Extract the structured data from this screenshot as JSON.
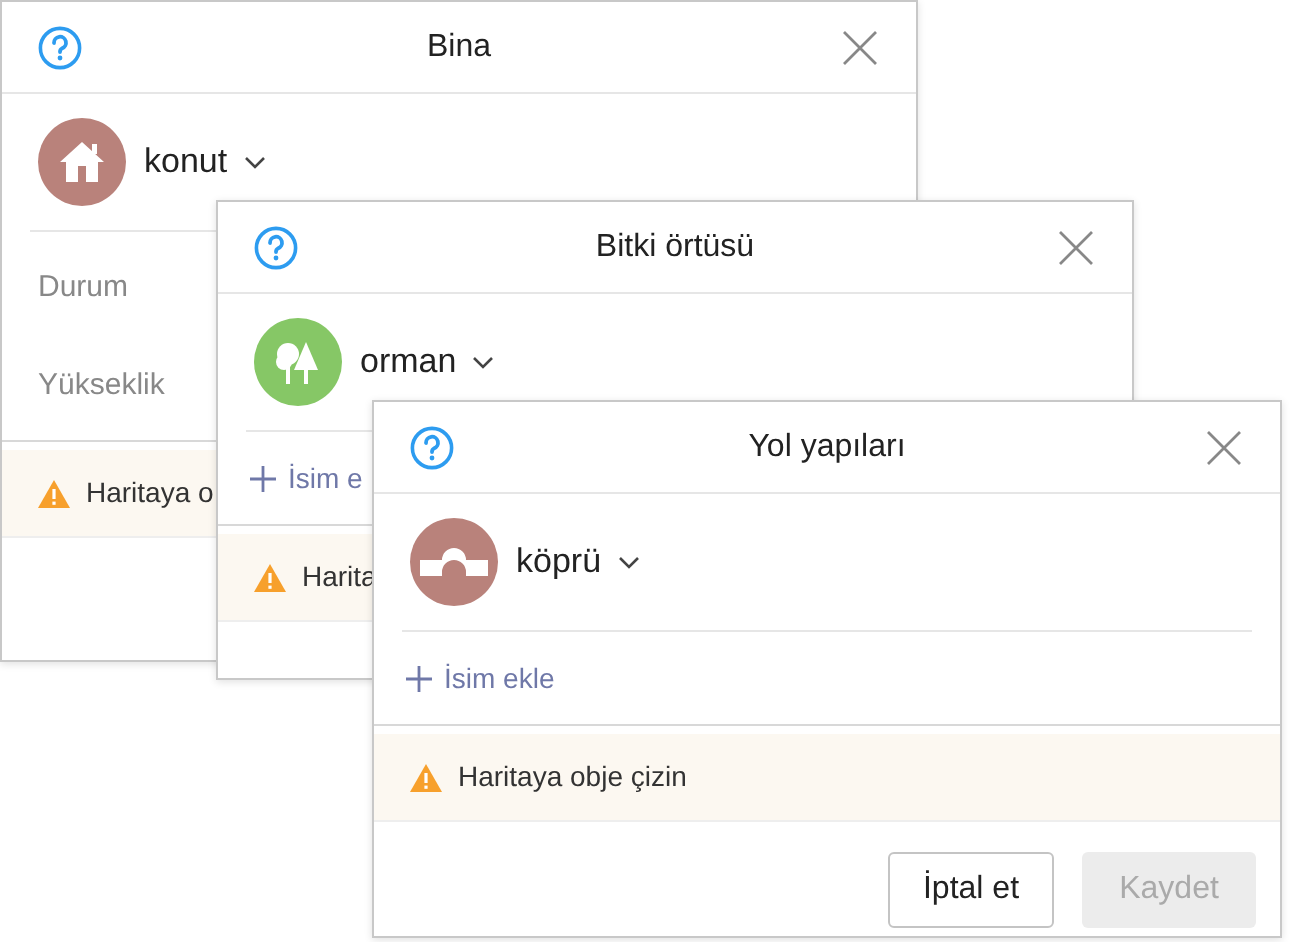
{
  "dialogs": [
    {
      "title": "Bina",
      "category": {
        "label": "konut",
        "kind": "house",
        "color": "#b9827b"
      },
      "fields": [
        {
          "label": "Durum"
        },
        {
          "label": "Yükseklik"
        }
      ],
      "warning": "Haritaya o"
    },
    {
      "title": "Bitki örtüsü",
      "category": {
        "label": "orman",
        "kind": "trees",
        "color": "#86c766"
      },
      "add_name": "İsim e",
      "warning": "Harita"
    },
    {
      "title": "Yol yapıları",
      "category": {
        "label": "köprü",
        "kind": "bridge",
        "color": "#b9827b"
      },
      "add_name": "İsim ekle",
      "warning": "Haritaya obje çizin",
      "buttons": [
        {
          "label": "İptal et",
          "kind": "secondary",
          "disabled": false
        },
        {
          "label": "Kaydet",
          "kind": "primary",
          "disabled": true
        }
      ]
    }
  ]
}
